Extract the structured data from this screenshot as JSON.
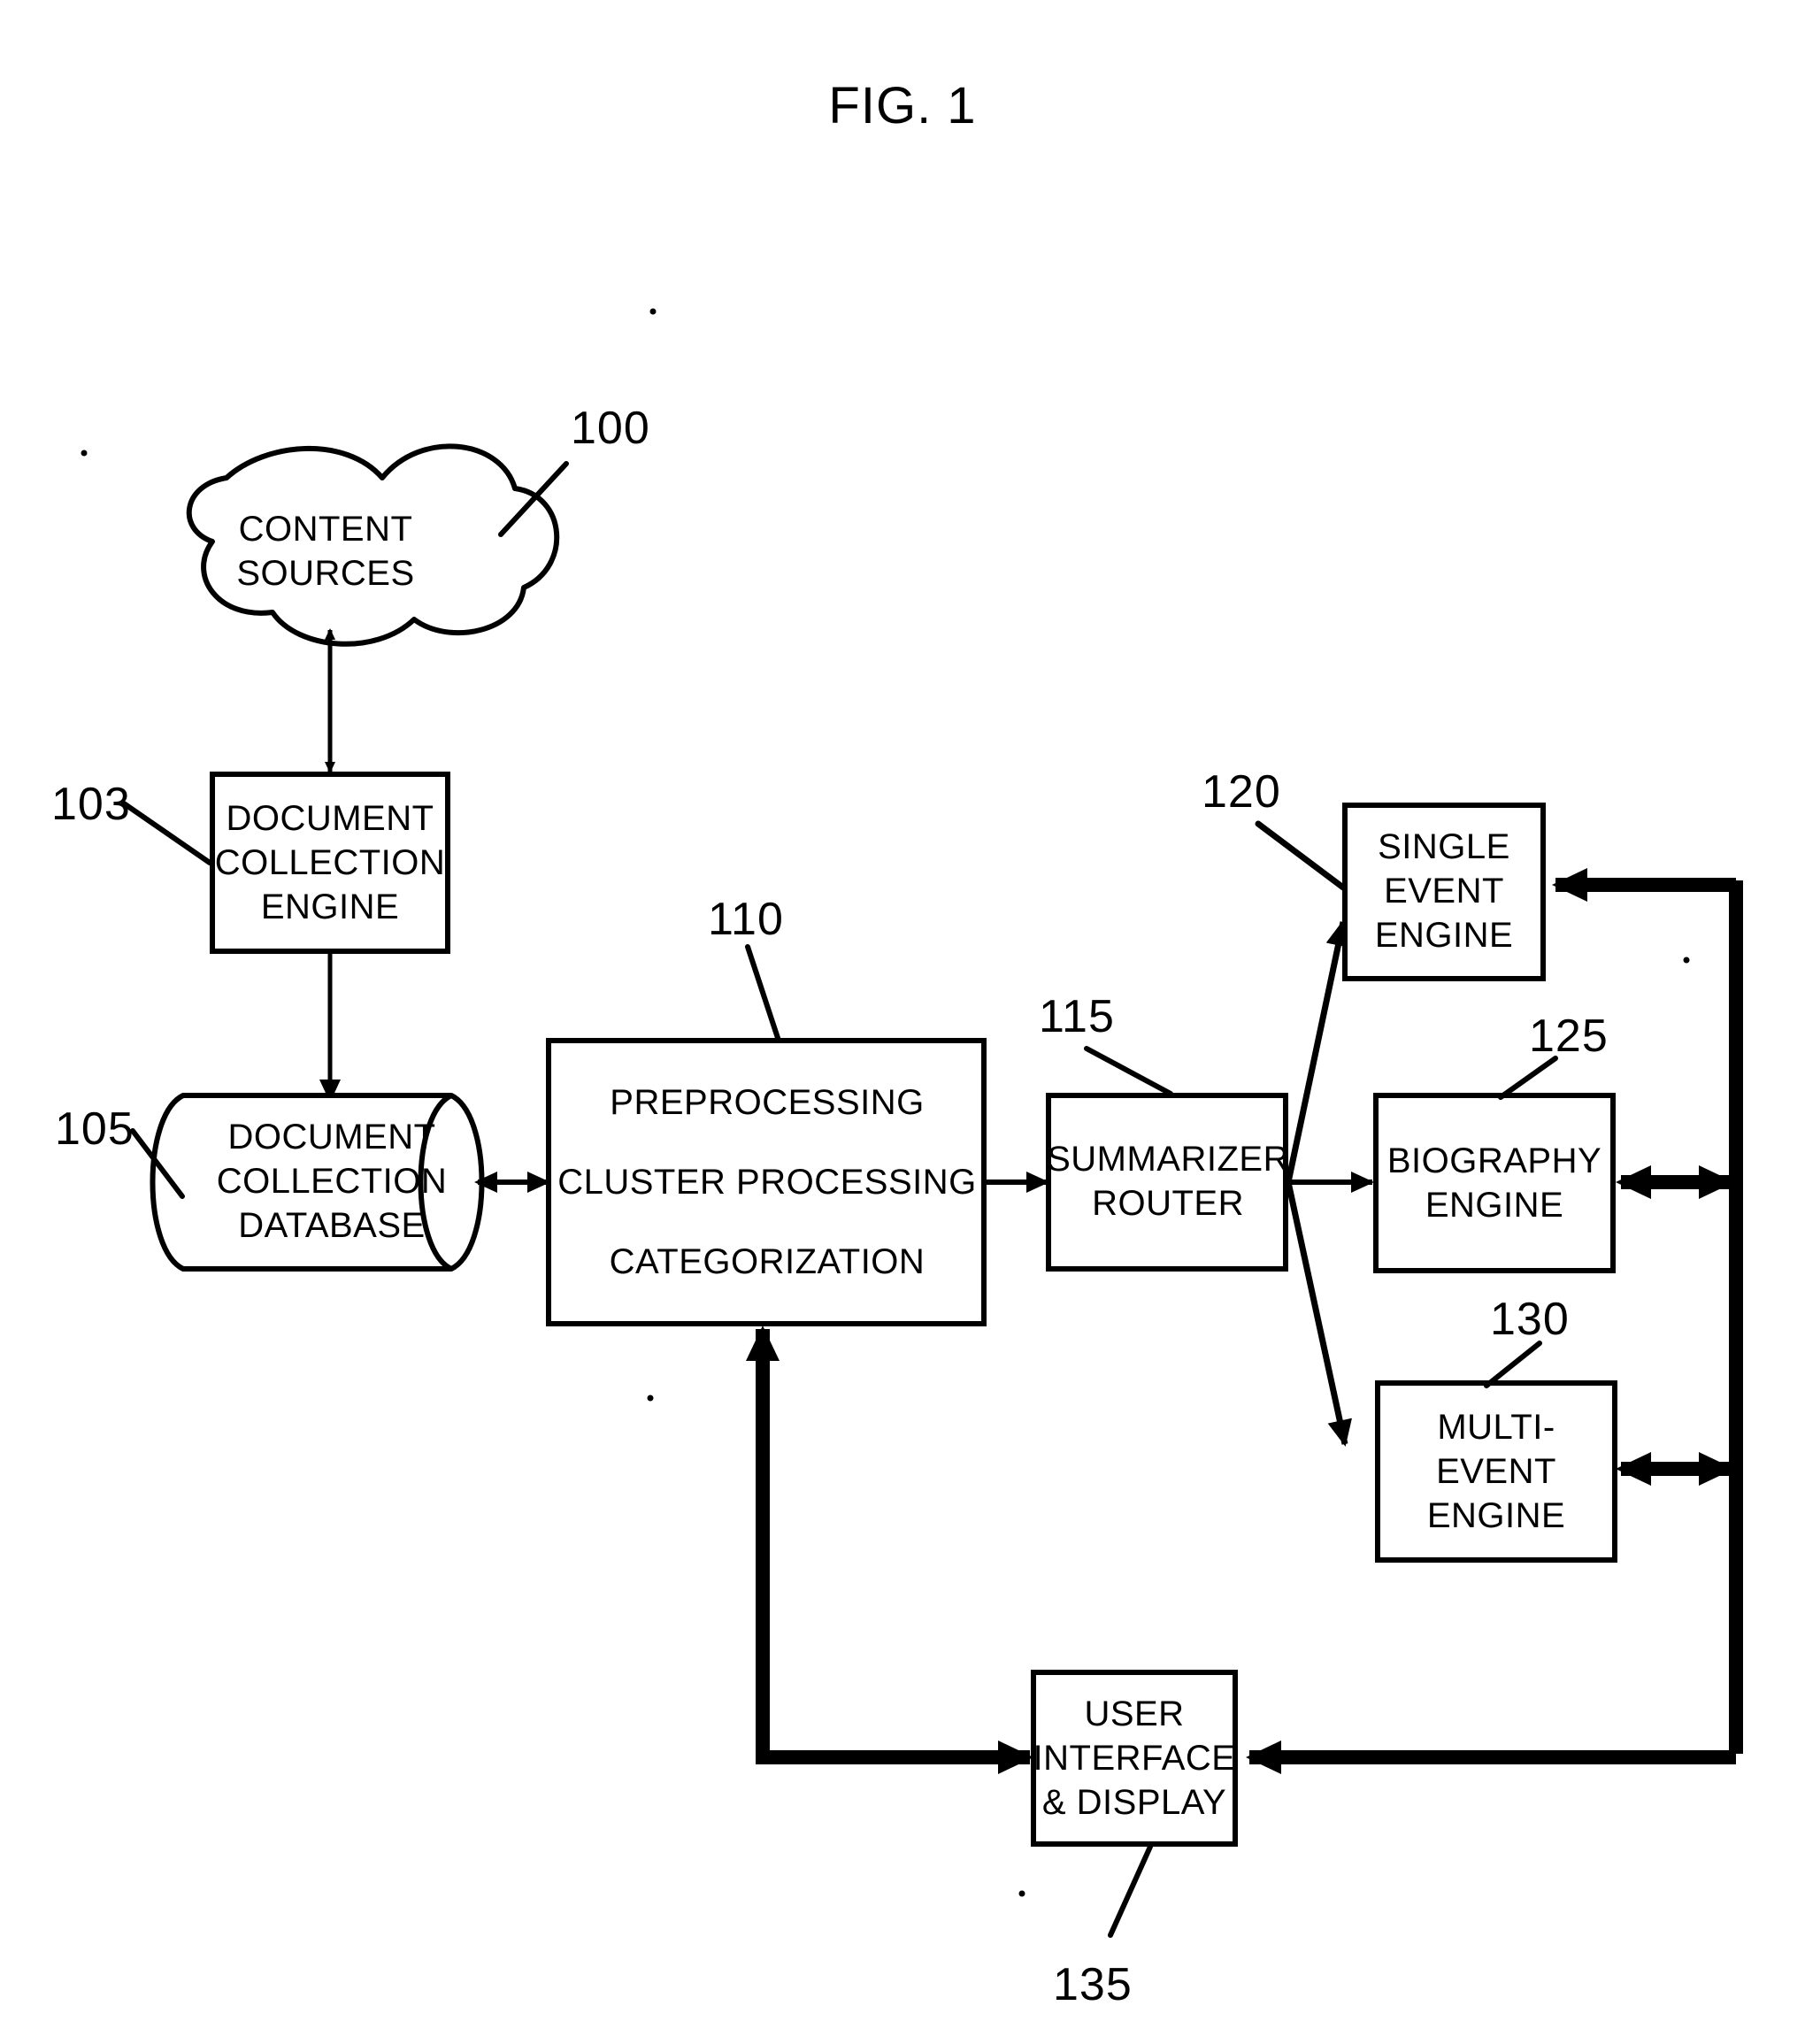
{
  "figure": {
    "title": "FIG. 1",
    "domain": "patent-block-diagram"
  },
  "nodes": {
    "content_sources": {
      "label": "CONTENT\nSOURCES",
      "shape": "cloud",
      "ref": "100"
    },
    "document_collection_engine": {
      "label": "DOCUMENT\nCOLLECTION\nENGINE",
      "shape": "rect",
      "ref": "103"
    },
    "document_collection_database": {
      "label": "DOCUMENT\nCOLLECTION\nDATABASE",
      "shape": "cylinder",
      "ref": "105"
    },
    "preprocessing": {
      "label": "PREPROCESSING\nCLUSTER PROCESSING\nCATEGORIZATION",
      "line1": "PREPROCESSING",
      "line2": "CLUSTER PROCESSING",
      "line3": "CATEGORIZATION",
      "shape": "rect",
      "ref": "110"
    },
    "summarizer_router": {
      "label": "SUMMARIZER\nROUTER",
      "shape": "rect",
      "ref": "115"
    },
    "single_event_engine": {
      "label": "SINGLE\nEVENT\nENGINE",
      "shape": "rect",
      "ref": "120"
    },
    "biography_engine": {
      "label": "BIOGRAPHY\nENGINE",
      "shape": "rect",
      "ref": "125"
    },
    "multi_event_engine": {
      "label": "MULTI-\nEVENT\nENGINE",
      "shape": "rect",
      "ref": "130"
    },
    "user_interface_display": {
      "label": "USER\nINTERFACE\n& DISPLAY",
      "shape": "rect",
      "ref": "135"
    }
  },
  "reference_numerals": {
    "n100": "100",
    "n103": "103",
    "n105": "105",
    "n110": "110",
    "n115": "115",
    "n120": "120",
    "n125": "125",
    "n130": "130",
    "n135": "135"
  },
  "connections": [
    {
      "from": "content_sources",
      "to": "document_collection_engine",
      "arrow": "double",
      "weight": "thin"
    },
    {
      "from": "document_collection_engine",
      "to": "document_collection_database",
      "arrow": "single",
      "weight": "thin"
    },
    {
      "from": "document_collection_database",
      "to": "preprocessing",
      "arrow": "double",
      "weight": "thin"
    },
    {
      "from": "preprocessing",
      "to": "summarizer_router",
      "arrow": "single",
      "weight": "thin"
    },
    {
      "from": "summarizer_router",
      "to": "single_event_engine",
      "arrow": "single",
      "weight": "thin"
    },
    {
      "from": "summarizer_router",
      "to": "biography_engine",
      "arrow": "single",
      "weight": "thin"
    },
    {
      "from": "summarizer_router",
      "to": "multi_event_engine",
      "arrow": "single",
      "weight": "thin"
    },
    {
      "from": "bus",
      "to": "single_event_engine",
      "arrow": "single",
      "weight": "thick"
    },
    {
      "from": "biography_engine",
      "to": "bus",
      "arrow": "double",
      "weight": "thick"
    },
    {
      "from": "multi_event_engine",
      "to": "bus",
      "arrow": "double",
      "weight": "thick"
    },
    {
      "from": "bus",
      "to": "user_interface_display",
      "arrow": "single",
      "weight": "thick"
    },
    {
      "from": "user_interface_display",
      "to": "preprocessing",
      "arrow": "single",
      "weight": "thick"
    }
  ],
  "colors": {
    "ink": "#000000",
    "background": "#ffffff"
  }
}
